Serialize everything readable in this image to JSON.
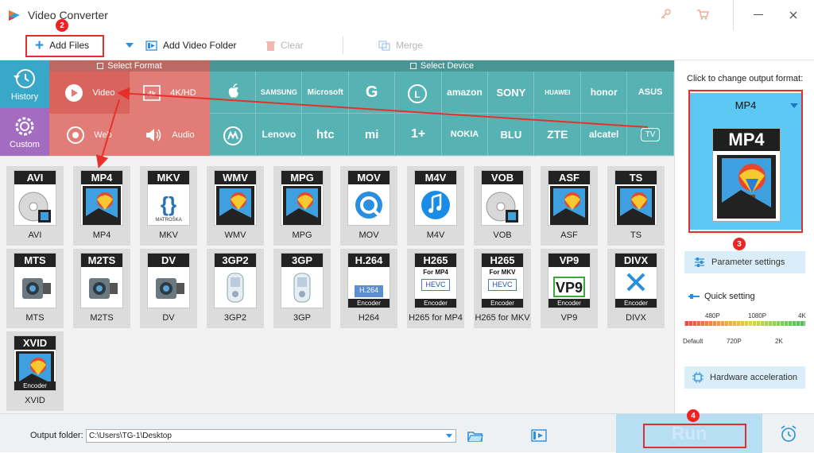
{
  "app": {
    "title": "Video Converter"
  },
  "toolbar": {
    "add_files": "Add Files",
    "add_video_folder": "Add Video Folder",
    "clear": "Clear",
    "merge": "Merge"
  },
  "markers": {
    "m1": "2",
    "m2": "3",
    "m3": "4"
  },
  "sidebar": {
    "history": "History",
    "custom": "Custom"
  },
  "format_panel": {
    "header": "Select Format",
    "video": "Video",
    "hd": "4K/HD",
    "web": "Web",
    "audio": "Audio"
  },
  "device_panel": {
    "header": "Select Device",
    "row1": [
      "",
      "SAMSUNG",
      "Microsoft",
      "G",
      "",
      "amazon",
      "SONY",
      "HUAWEI",
      "honor",
      "ASUS"
    ],
    "row2": [
      "",
      "Lenovo",
      "htc",
      "mi",
      "1+",
      "NOKIA",
      "BLU",
      "ZTE",
      "alcatel",
      "TV"
    ]
  },
  "formats": [
    {
      "badge": "AVI",
      "label": "AVI",
      "style": "disc"
    },
    {
      "badge": "MP4",
      "label": "MP4",
      "style": "film"
    },
    {
      "badge": "MKV",
      "label": "MKV",
      "style": "mkv"
    },
    {
      "badge": "WMV",
      "label": "WMV",
      "style": "film"
    },
    {
      "badge": "MPG",
      "label": "MPG",
      "style": "film"
    },
    {
      "badge": "MOV",
      "label": "MOV",
      "style": "qt"
    },
    {
      "badge": "M4V",
      "label": "M4V",
      "style": "itunes"
    },
    {
      "badge": "VOB",
      "label": "VOB",
      "style": "disc"
    },
    {
      "badge": "ASF",
      "label": "ASF",
      "style": "film"
    },
    {
      "badge": "TS",
      "label": "TS",
      "style": "film"
    },
    {
      "badge": "MTS",
      "label": "MTS",
      "style": "cam"
    },
    {
      "badge": "M2TS",
      "label": "M2TS",
      "style": "cam"
    },
    {
      "badge": "DV",
      "label": "DV",
      "style": "cam"
    },
    {
      "badge": "3GP2",
      "label": "3GP2",
      "style": "phone"
    },
    {
      "badge": "3GP",
      "label": "3GP",
      "style": "phone"
    },
    {
      "badge": "H.264",
      "label": "H264",
      "style": "h264",
      "inner": "H.264",
      "enc": "Encoder"
    },
    {
      "badge": "H265",
      "label": "H265 for MP4",
      "style": "hevc",
      "sub": "For MP4",
      "inner": "HEVC",
      "enc": "Encoder"
    },
    {
      "badge": "H265",
      "label": "H265 for MKV",
      "style": "hevc",
      "sub": "For MKV",
      "inner": "HEVC",
      "enc": "Encoder"
    },
    {
      "badge": "VP9",
      "label": "VP9",
      "style": "vp9",
      "inner": "VP9",
      "enc": "Encoder"
    },
    {
      "badge": "DIVX",
      "label": "DIVX",
      "style": "divx",
      "enc": "Encoder"
    },
    {
      "badge": "XVID",
      "label": "XVID",
      "style": "film",
      "enc": "Encoder"
    }
  ],
  "output_panel": {
    "prompt": "Click to change output format:",
    "format": "MP4",
    "format_big": "MP4",
    "parameter_settings": "Parameter settings",
    "quick_setting": "Quick setting",
    "slider_top": [
      "480P",
      "1080P",
      "4K"
    ],
    "slider_bottom": [
      "Default",
      "720P",
      "2K"
    ],
    "hardware": "Hardware acceleration"
  },
  "bottom": {
    "output_label": "Output folder:",
    "path": "C:\\Users\\TG-1\\Desktop",
    "run": "Run"
  },
  "colors": {
    "format_bg": "#e17c76",
    "device_bg": "#57b2b3",
    "accent": "#29a9e8",
    "history_bg": "#38a7c8",
    "custom_bg": "#a36cc1",
    "marker": "#e22222"
  }
}
